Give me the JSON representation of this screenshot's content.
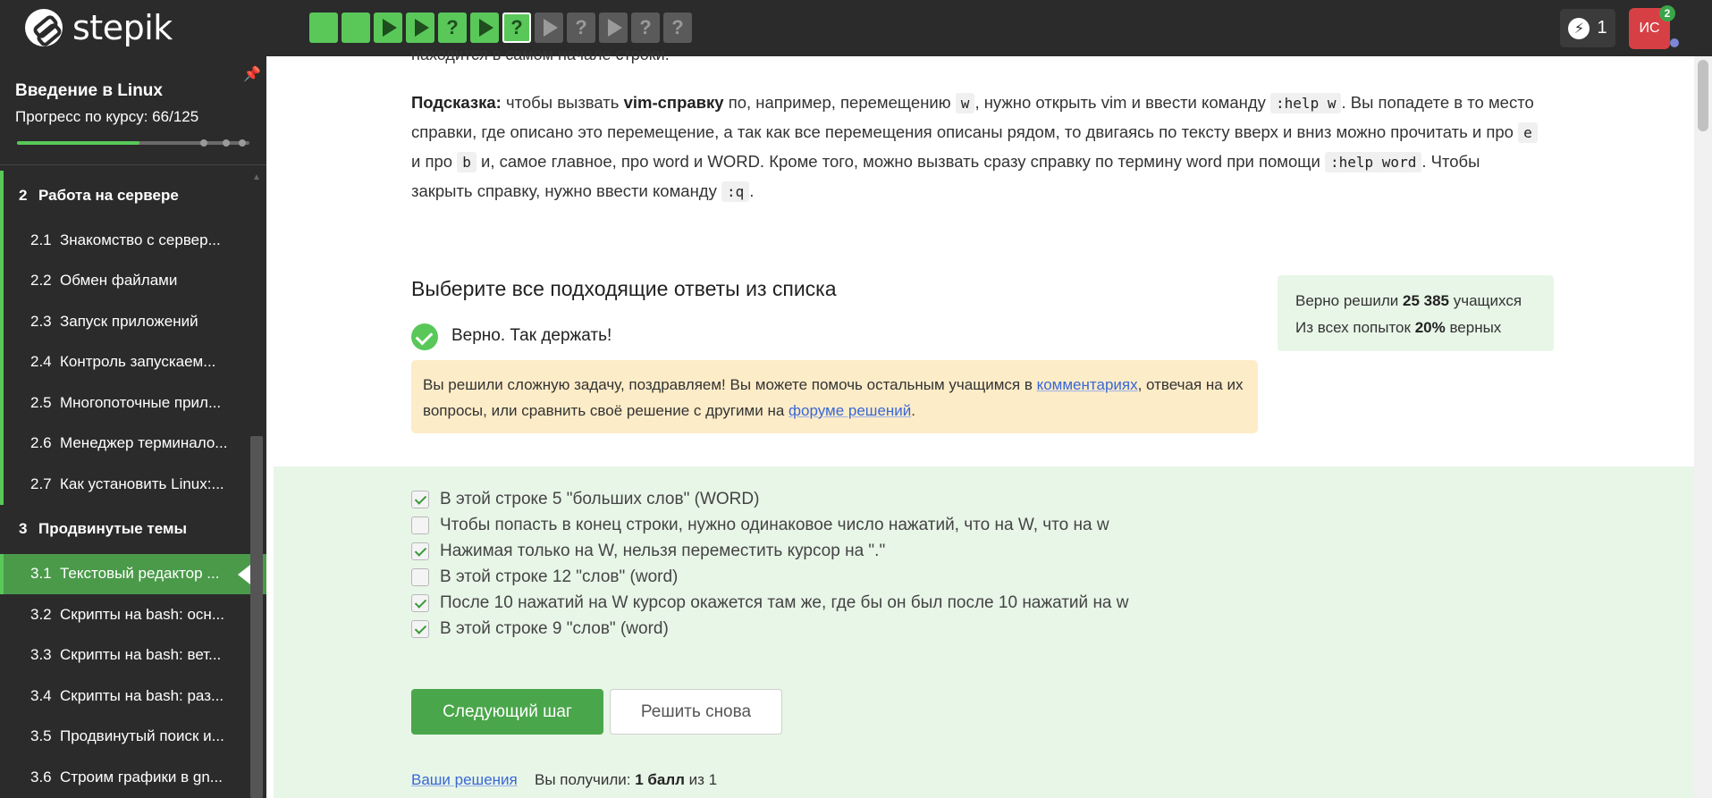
{
  "app": {
    "name": "stepik"
  },
  "steps": [
    {
      "state": "green",
      "icon": "square"
    },
    {
      "state": "green",
      "icon": "square"
    },
    {
      "state": "green",
      "icon": "play"
    },
    {
      "state": "green",
      "icon": "play"
    },
    {
      "state": "green",
      "icon": "question",
      "label": "?"
    },
    {
      "state": "green",
      "icon": "play"
    },
    {
      "state": "current",
      "icon": "question",
      "label": "?"
    },
    {
      "state": "grey",
      "icon": "play"
    },
    {
      "state": "grey",
      "icon": "question",
      "label": "?"
    },
    {
      "state": "grey",
      "icon": "play"
    },
    {
      "state": "grey",
      "icon": "question",
      "label": "?"
    },
    {
      "state": "grey",
      "icon": "question",
      "label": "?"
    }
  ],
  "header": {
    "energy_count": "1",
    "avatar_initials": "ИС",
    "avatar_badge": "2"
  },
  "sidebar": {
    "course_title": "Введение в Linux",
    "progress_label": "Прогресс по курсу:  66/125",
    "progress_fraction": 0.528,
    "sections": [
      {
        "number": "2",
        "title": "Работа на сервере",
        "items": [
          {
            "number": "2.1",
            "title": "Знакомство с сервер..."
          },
          {
            "number": "2.2",
            "title": "Обмен файлами"
          },
          {
            "number": "2.3",
            "title": "Запуск приложений"
          },
          {
            "number": "2.4",
            "title": "Контроль запускаем..."
          },
          {
            "number": "2.5",
            "title": "Многопоточные прил..."
          },
          {
            "number": "2.6",
            "title": "Менеджер терминало..."
          },
          {
            "number": "2.7",
            "title": "Как установить Linux:..."
          }
        ]
      },
      {
        "number": "3",
        "title": "Продвинутые темы",
        "items": [
          {
            "number": "3.1",
            "title": "Текстовый редактор ..."
          },
          {
            "number": "3.2",
            "title": "Скрипты на bash: осн..."
          },
          {
            "number": "3.3",
            "title": "Скрипты на bash: вет..."
          },
          {
            "number": "3.4",
            "title": "Скрипты на bash: раз..."
          },
          {
            "number": "3.5",
            "title": "Продвинутый поиск и..."
          },
          {
            "number": "3.6",
            "title": "Строим графики в gn..."
          }
        ]
      }
    ]
  },
  "main": {
    "partial_line": "находится в самом начале строки.",
    "hint": {
      "label": "Подсказка:",
      "t1": " чтобы вызвать ",
      "bold1": "vim-справку",
      "t2": " по, например, перемещению ",
      "code1": "w",
      "t3": ", нужно открыть vim и ввести команду ",
      "code2": ":help w",
      "t4": ". Вы попадете в то место справки, где описано это перемещение, а так как все перемещения описаны рядом, то двигаясь по тексту вверх и вниз можно прочитать и про ",
      "code3": "e",
      "t5": " и про ",
      "code4": "b",
      "t6": " и, самое главное, про word и WORD. Кроме того, можно вызвать сразу справку по термину word при помощи ",
      "code5": ":help word",
      "t7": ". Чтобы закрыть справку, нужно ввести команду ",
      "code6": ":q",
      "t8": "."
    },
    "task_title": "Выберите все подходящие ответы из списка",
    "correct_text": "Верно. Так держать!",
    "notice": {
      "t1": "Вы решили сложную задачу, поздравляем! Вы можете помочь остальным учащимся в ",
      "link1": "комментариях",
      "t2": ", отвечая на их вопросы, или сравнить своё решение с другими на ",
      "link2": "форуме решений",
      "t3": "."
    },
    "stats": {
      "l1_prefix": "Верно решили ",
      "l1_value": "25 385",
      "l1_suffix": " учащихся",
      "l2_prefix": "Из всех попыток ",
      "l2_value": "20%",
      "l2_suffix": " верных"
    },
    "options": [
      {
        "text": "В этой строке 5 \"больших слов\" (WORD)",
        "checked": true
      },
      {
        "text": "Чтобы попасть в конец строки, нужно одинаковое число нажатий, что на W, что на w",
        "checked": false
      },
      {
        "text": "Нажимая только на W, нельзя переместить курсор на \".\"",
        "checked": true
      },
      {
        "text": "В этой строке 12 \"слов\" (word)",
        "checked": false
      },
      {
        "text": "После 10 нажатий на W курсор окажется там же, где бы он был после 10 нажатий на w",
        "checked": true
      },
      {
        "text": "В этой строке 9 \"слов\" (word)",
        "checked": true
      }
    ],
    "next_button": "Следующий шаг",
    "retry_button": "Решить снова",
    "your_solutions": "Ваши решения",
    "score": {
      "prefix": "Вы получили: ",
      "value": "1 балл",
      "suffix": " из 1"
    }
  }
}
